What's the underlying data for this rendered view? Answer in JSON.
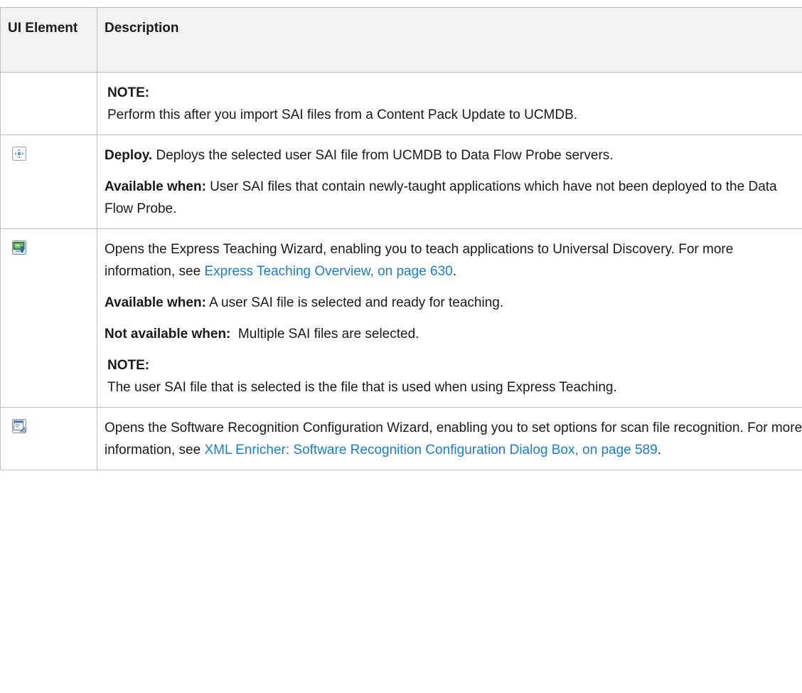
{
  "table": {
    "header": {
      "col1": "UI Element",
      "col2": "Description"
    },
    "rows": [
      {
        "note_label": "NOTE:",
        "note_text": "Perform this after you import SAI files from a Content Pack Update to UCMDB."
      },
      {
        "icon": "deploy-icon",
        "title": "Deploy.",
        "text": " Deploys the selected user SAI file from UCMDB to Data Flow Probe servers.",
        "avail_label": "Available when:",
        "avail_text": " User SAI files that contain newly-taught applications which have not been deployed to the Data Flow Probe."
      },
      {
        "icon": "express-teaching-icon",
        "text": "Opens the Express Teaching Wizard, enabling you to teach applications to Universal Discovery. For more information, see ",
        "link": "Express Teaching Overview, on page 630",
        "text_after": ".",
        "avail_label": "Available when:",
        "avail_text": " A user SAI file is selected and ready for teaching.",
        "not_avail_label": "Not available when:",
        "not_avail_text": "  Multiple SAI files are selected.",
        "note_label": "NOTE:",
        "note_text": "The user SAI file that is selected is the file that is used when using Express Teaching."
      },
      {
        "icon": "software-recognition-config-icon",
        "text": "Opens the Software Recognition Configuration Wizard, enabling you to set options for scan file recognition. For more information, see ",
        "link": "XML Enricher: Software Recognition Configuration Dialog Box, on page 589",
        "text_after": "."
      }
    ]
  }
}
